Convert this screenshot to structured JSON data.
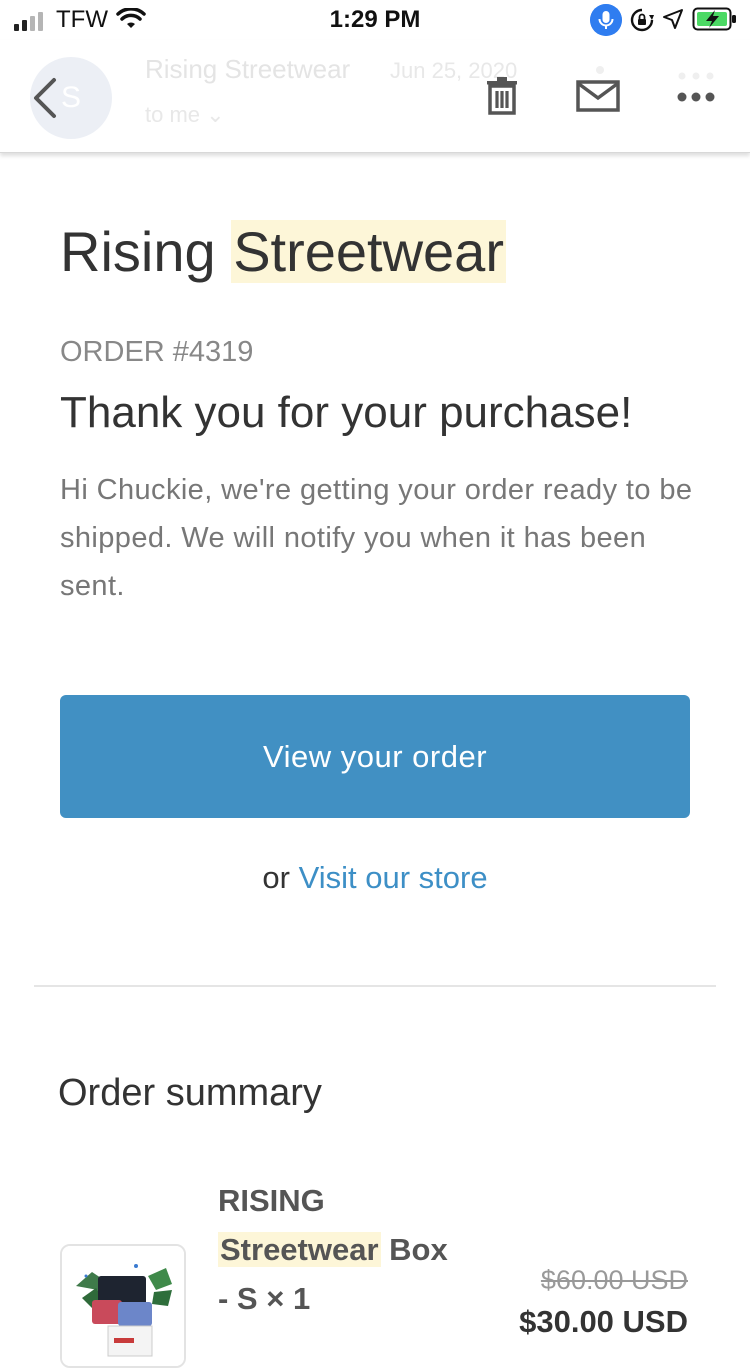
{
  "status_bar": {
    "carrier": "TFW",
    "time": "1:29 PM"
  },
  "header": {
    "avatar_letter": "S",
    "sender": "Rising Streetwear",
    "date": "Jun 25, 2020",
    "to": "to me ⌄"
  },
  "email": {
    "brand_part1": "Rising",
    "brand_part2": "Streetwear",
    "order_number": "ORDER #4319",
    "heading": "Thank you for your purchase!",
    "message": "Hi Chuckie, we're getting your order ready to be shipped. We will notify you when it has been sent.",
    "view_order_label": "View your order",
    "or_text": "or",
    "visit_store_label": "Visit our store",
    "summary_heading": "Order summary",
    "item": {
      "title_line1": "RISING",
      "title_highlight": "Streetwear",
      "title_rest": " Box",
      "variant": "- S × 1",
      "original_price": "$60.00 USD",
      "price": "$30.00 USD"
    }
  },
  "colors": {
    "button": "#4190c3",
    "link": "#3d8fc6",
    "highlight": "#fdf6d8"
  }
}
